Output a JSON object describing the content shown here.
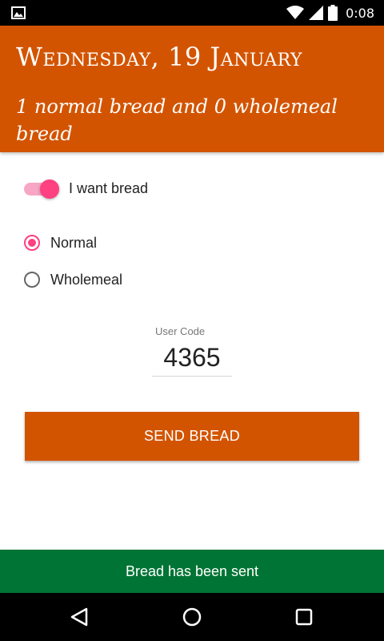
{
  "status_bar": {
    "time": "0:08",
    "icons": [
      "image-icon",
      "wifi-icon",
      "signal-icon",
      "battery-icon"
    ]
  },
  "header": {
    "date": "Wednesday, 19 January",
    "summary": "1 normal bread and 0 wholemeal bread",
    "color": "#d35400"
  },
  "switch": {
    "label": "I want bread",
    "on": true,
    "accent": "#ff4081"
  },
  "bread_type": {
    "options": [
      {
        "label": "Normal",
        "selected": true
      },
      {
        "label": "Wholemeal",
        "selected": false
      }
    ]
  },
  "user_code": {
    "label": "User Code",
    "value": "4365"
  },
  "send_button": {
    "label": "SEND BREAD"
  },
  "snackbar": {
    "message": "Bread has been sent",
    "color": "#007434"
  },
  "nav_bar": {
    "icons": [
      "back-icon",
      "home-icon",
      "recent-apps-icon"
    ]
  }
}
